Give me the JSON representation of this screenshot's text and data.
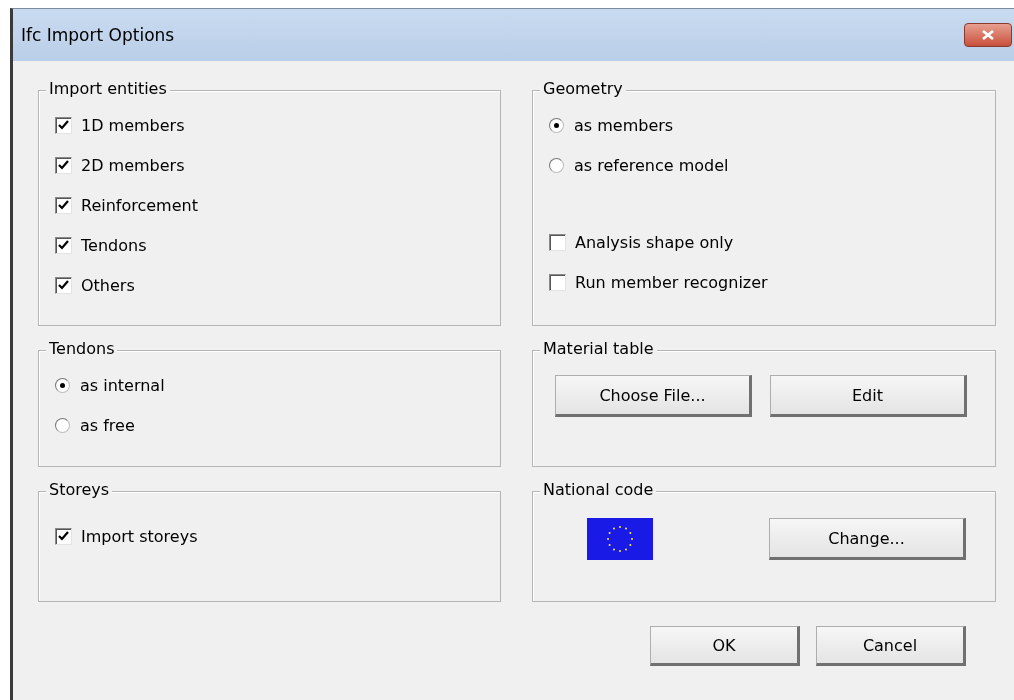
{
  "window": {
    "title": "Ifc Import Options"
  },
  "import_entities": {
    "title": "Import entities",
    "items": [
      {
        "label": "1D members",
        "checked": true
      },
      {
        "label": "2D members",
        "checked": true
      },
      {
        "label": "Reinforcement",
        "checked": true
      },
      {
        "label": "Tendons",
        "checked": true
      },
      {
        "label": "Others",
        "checked": true
      }
    ]
  },
  "geometry": {
    "title": "Geometry",
    "options": [
      {
        "label": "as members",
        "selected": true
      },
      {
        "label": "as reference model",
        "selected": false
      }
    ],
    "checks": [
      {
        "label": "Analysis shape only",
        "checked": false
      },
      {
        "label": "Run member recognizer",
        "checked": false
      }
    ]
  },
  "tendons": {
    "title": "Tendons",
    "options": [
      {
        "label": "as internal",
        "selected": true
      },
      {
        "label": "as free",
        "selected": false
      }
    ]
  },
  "material_table": {
    "title": "Material table",
    "buttons": [
      "Choose File...",
      "Edit"
    ]
  },
  "storeys": {
    "title": "Storeys",
    "items": [
      {
        "label": "Import storeys",
        "checked": true
      }
    ]
  },
  "national_code": {
    "title": "National code",
    "button": "Change..."
  },
  "buttons": [
    "OK",
    "Cancel"
  ]
}
